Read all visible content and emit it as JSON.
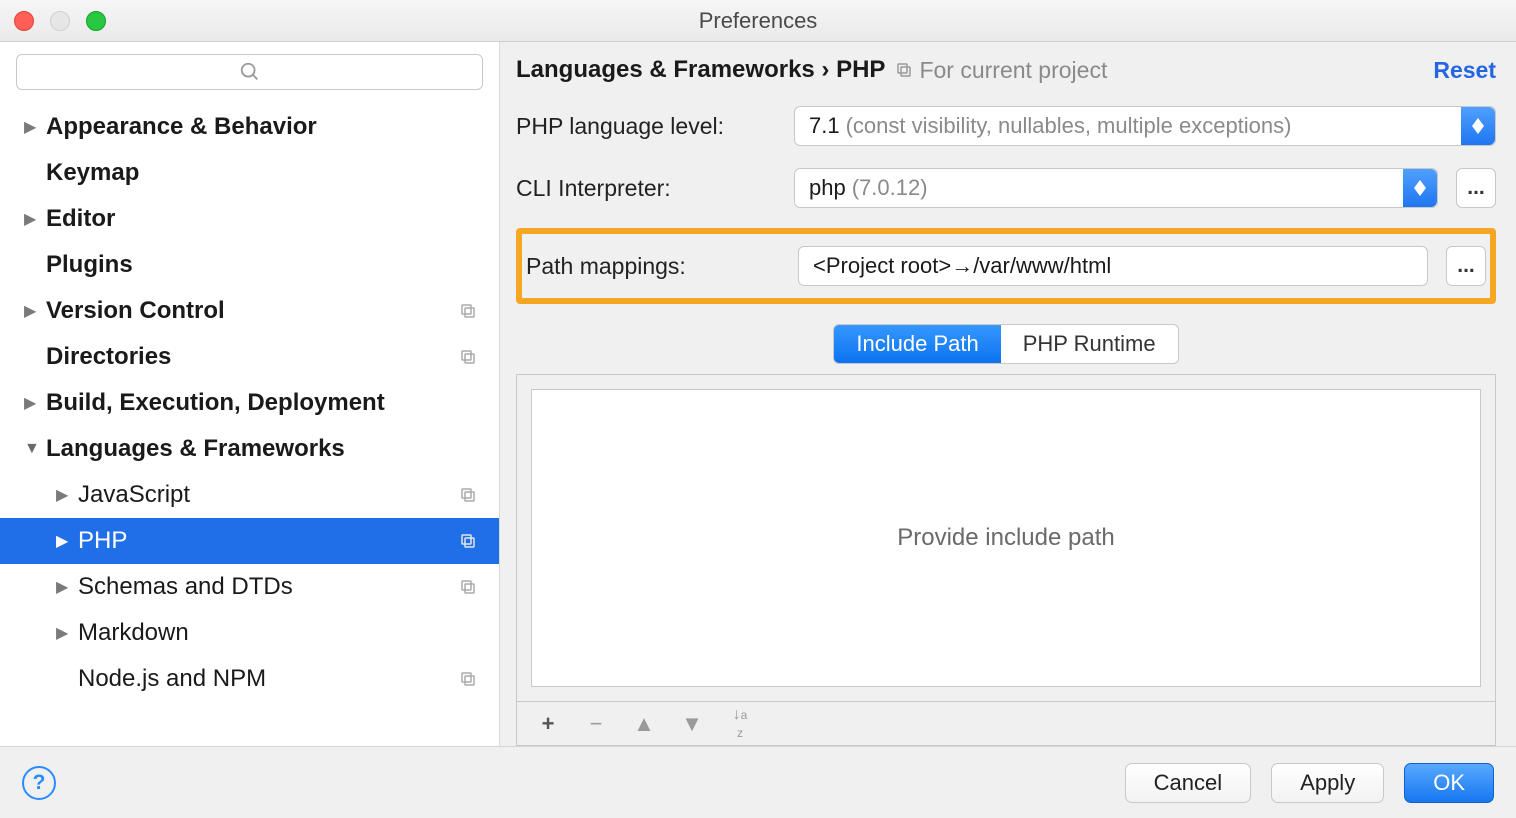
{
  "window": {
    "title": "Preferences"
  },
  "sidebar": {
    "search_placeholder": "",
    "items": [
      {
        "label": "Appearance & Behavior",
        "bold": true,
        "tri": true,
        "expanded": false,
        "level": 0,
        "badge": false
      },
      {
        "label": "Keymap",
        "bold": true,
        "tri": false,
        "expanded": false,
        "level": 0,
        "badge": false
      },
      {
        "label": "Editor",
        "bold": true,
        "tri": true,
        "expanded": false,
        "level": 0,
        "badge": false
      },
      {
        "label": "Plugins",
        "bold": true,
        "tri": false,
        "expanded": false,
        "level": 0,
        "badge": false
      },
      {
        "label": "Version Control",
        "bold": true,
        "tri": true,
        "expanded": false,
        "level": 0,
        "badge": true
      },
      {
        "label": "Directories",
        "bold": true,
        "tri": false,
        "expanded": false,
        "level": 0,
        "badge": true
      },
      {
        "label": "Build, Execution, Deployment",
        "bold": true,
        "tri": true,
        "expanded": false,
        "level": 0,
        "badge": false
      },
      {
        "label": "Languages & Frameworks",
        "bold": true,
        "tri": true,
        "expanded": true,
        "level": 0,
        "badge": false
      },
      {
        "label": "JavaScript",
        "bold": false,
        "tri": true,
        "expanded": false,
        "level": 1,
        "badge": true
      },
      {
        "label": "PHP",
        "bold": false,
        "tri": true,
        "expanded": false,
        "level": 1,
        "badge": true,
        "selected": true
      },
      {
        "label": "Schemas and DTDs",
        "bold": false,
        "tri": true,
        "expanded": false,
        "level": 1,
        "badge": true
      },
      {
        "label": "Markdown",
        "bold": false,
        "tri": true,
        "expanded": false,
        "level": 1,
        "badge": false
      },
      {
        "label": "Node.js and NPM",
        "bold": false,
        "tri": false,
        "expanded": false,
        "level": 1,
        "badge": true
      }
    ]
  },
  "main": {
    "breadcrumb": "Languages & Frameworks › PHP",
    "scope": "For current project",
    "reset": "Reset",
    "lang_level_label": "PHP language level:",
    "lang_level_value": "7.1",
    "lang_level_hint": "(const visibility, nullables, multiple exceptions)",
    "cli_label": "CLI Interpreter:",
    "cli_value": "php",
    "cli_hint": "(7.0.12)",
    "path_label": "Path mappings:",
    "path_value": "<Project root>→/var/www/html",
    "tabs": {
      "a": "Include Path",
      "b": "PHP Runtime"
    },
    "panel_placeholder": "Provide include path"
  },
  "footer": {
    "cancel": "Cancel",
    "apply": "Apply",
    "ok": "OK"
  }
}
